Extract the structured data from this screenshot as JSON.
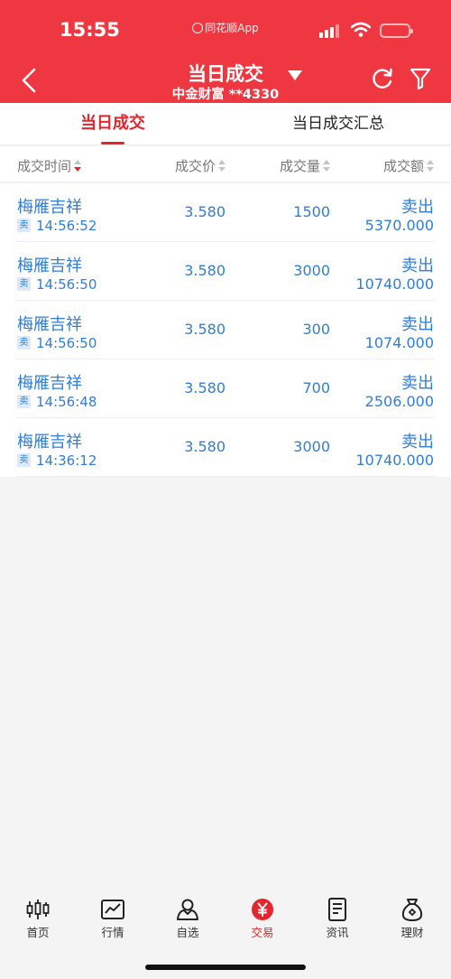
{
  "status_bar": {
    "time": "15:55",
    "app_name": "同花顺App"
  },
  "header": {
    "title": "当日成交",
    "account": "中金财富 **4330"
  },
  "tabs": [
    {
      "label": "当日成交",
      "active": true
    },
    {
      "label": "当日成交汇总",
      "active": false
    }
  ],
  "columns": {
    "time": "成交时间",
    "price": "成交价",
    "qty": "成交量",
    "amount": "成交额"
  },
  "rows": [
    {
      "name": "梅雁吉祥",
      "badge": "卖",
      "time": "14:56:52",
      "price": "3.580",
      "qty": "1500",
      "side": "卖出",
      "amount": "5370.000"
    },
    {
      "name": "梅雁吉祥",
      "badge": "卖",
      "time": "14:56:50",
      "price": "3.580",
      "qty": "3000",
      "side": "卖出",
      "amount": "10740.000"
    },
    {
      "name": "梅雁吉祥",
      "badge": "卖",
      "time": "14:56:50",
      "price": "3.580",
      "qty": "300",
      "side": "卖出",
      "amount": "1074.000"
    },
    {
      "name": "梅雁吉祥",
      "badge": "卖",
      "time": "14:56:48",
      "price": "3.580",
      "qty": "700",
      "side": "卖出",
      "amount": "2506.000"
    },
    {
      "name": "梅雁吉祥",
      "badge": "卖",
      "time": "14:36:12",
      "price": "3.580",
      "qty": "3000",
      "side": "卖出",
      "amount": "10740.000"
    }
  ],
  "tabbar": [
    {
      "label": "首页",
      "icon": "candlestick-icon",
      "active": false
    },
    {
      "label": "行情",
      "icon": "line-chart-icon",
      "active": false
    },
    {
      "label": "自选",
      "icon": "person-icon",
      "active": false
    },
    {
      "label": "交易",
      "icon": "yuan-icon",
      "active": true
    },
    {
      "label": "资讯",
      "icon": "document-icon",
      "active": false
    },
    {
      "label": "理财",
      "icon": "money-bag-icon",
      "active": false
    }
  ],
  "colors": {
    "brand_red": "#ee3740",
    "active_tab_red": "#e5252e",
    "data_blue": "#2f7ed8"
  }
}
